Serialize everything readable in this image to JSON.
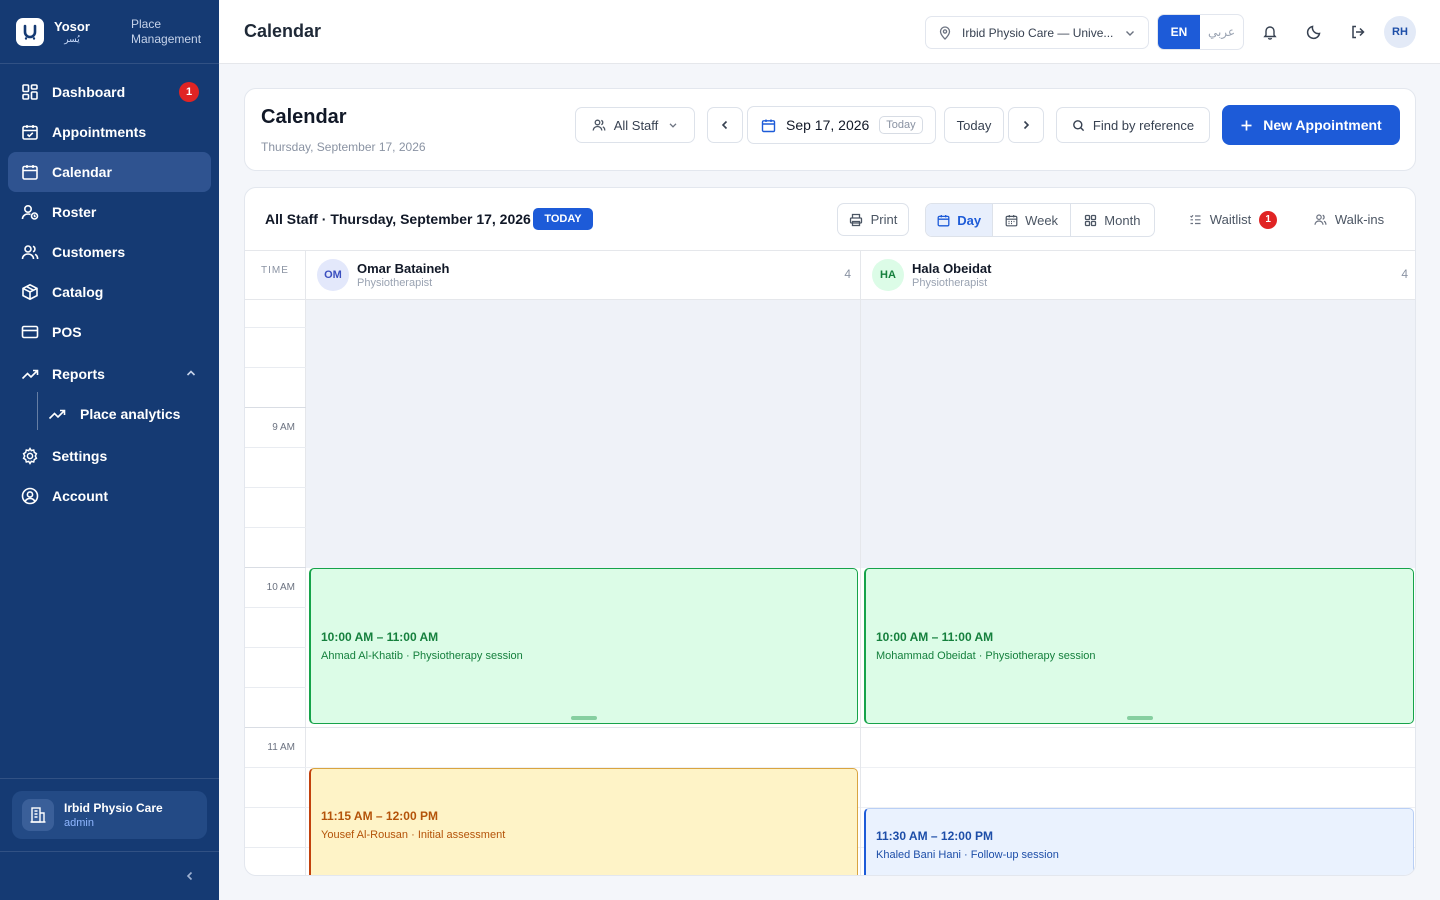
{
  "brand": {
    "name": "Yosor",
    "name_ar": "يُسر",
    "subtitle": "Place Management"
  },
  "sidebar": {
    "items": [
      {
        "label": "Dashboard",
        "badge": "1"
      },
      {
        "label": "Appointments"
      },
      {
        "label": "Calendar",
        "active": true
      },
      {
        "label": "Roster"
      },
      {
        "label": "Customers"
      },
      {
        "label": "Catalog"
      },
      {
        "label": "POS"
      },
      {
        "label": "Reports"
      },
      {
        "label": "Place analytics"
      },
      {
        "label": "Settings"
      },
      {
        "label": "Account"
      }
    ],
    "place": {
      "name": "Irbid Physio Care",
      "role": "admin"
    }
  },
  "topbar": {
    "title": "Calendar",
    "location": "Irbid Physio Care — Unive...",
    "lang_en": "EN",
    "lang_ar": "عربي",
    "avatar": "RH"
  },
  "header": {
    "title": "Calendar",
    "date": "Thursday, September 17, 2026",
    "staff_filter": "All Staff",
    "current_date": "Sep 17, 2026",
    "today_chip": "Today",
    "today_button": "Today",
    "find_label": "Find by reference",
    "new_label": "New Appointment"
  },
  "toolbar": {
    "title": "All Staff · Thursday, September 17, 2026",
    "today_badge": "TODAY",
    "print": "Print",
    "views": [
      "Day",
      "Week",
      "Month"
    ],
    "waitlist": "Waitlist",
    "waitlist_count": "1",
    "walkins": "Walk-ins"
  },
  "grid": {
    "time_header": "TIME",
    "hours": [
      "9 AM",
      "10 AM",
      "11 AM"
    ]
  },
  "staff": [
    {
      "initials": "OM",
      "name": "Omar Bataineh",
      "role": "Physiotherapist",
      "count": "4",
      "appointments": [
        {
          "time": "10:00 AM – 11:00 AM",
          "desc": "Ahmad Al-Khatib · Physiotherapy session",
          "status": "confirmed"
        },
        {
          "time": "11:15 AM – 12:00 PM",
          "desc": "Yousef Al-Rousan · Initial assessment",
          "status": "pending"
        }
      ]
    },
    {
      "initials": "HA",
      "name": "Hala Obeidat",
      "role": "Physiotherapist",
      "count": "4",
      "appointments": [
        {
          "time": "10:00 AM – 11:00 AM",
          "desc": "Mohammad Obeidat · Physiotherapy session",
          "status": "confirmed"
        },
        {
          "time": "11:30 AM – 12:00 PM",
          "desc": "Khaled Bani Hani · Follow-up session",
          "status": "scheduled"
        }
      ]
    }
  ],
  "colors": {
    "sidebar": "#153a73",
    "primary": "#1d5bd8",
    "confirmed": "#16a34a",
    "pending": "#d9a441",
    "scheduled": "#1d5bd8",
    "badge": "#e02424"
  }
}
